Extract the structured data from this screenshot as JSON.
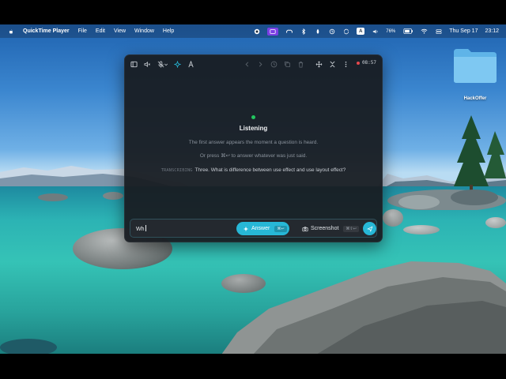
{
  "menubar": {
    "app_name": "QuickTime Player",
    "menus": [
      "File",
      "Edit",
      "View",
      "Window",
      "Help"
    ],
    "battery": "76%",
    "date": "Thu Sep 17",
    "time": "23:12",
    "input_source": "A"
  },
  "desktop": {
    "folder_label": "HackOffer"
  },
  "window": {
    "timer": "08:57",
    "status_title": "Listening",
    "hint_1": "The first answer appears the moment a question is heard.",
    "hint_2": "Or press ⌘↩ to answer whatever was just said.",
    "transcript_tag": "TRANSCRIBING",
    "transcript_text": "Three. What is difference between use effect and use layout effect?",
    "input_value": "Wh",
    "answer_label": "Answer",
    "answer_shortcut": "⌘↩",
    "screenshot_label": "Screenshot",
    "screenshot_shortcut": "⌘⇧↩",
    "colors": {
      "accent": "#27b7d6",
      "status": "#22c55e",
      "record": "#e5484d"
    }
  }
}
